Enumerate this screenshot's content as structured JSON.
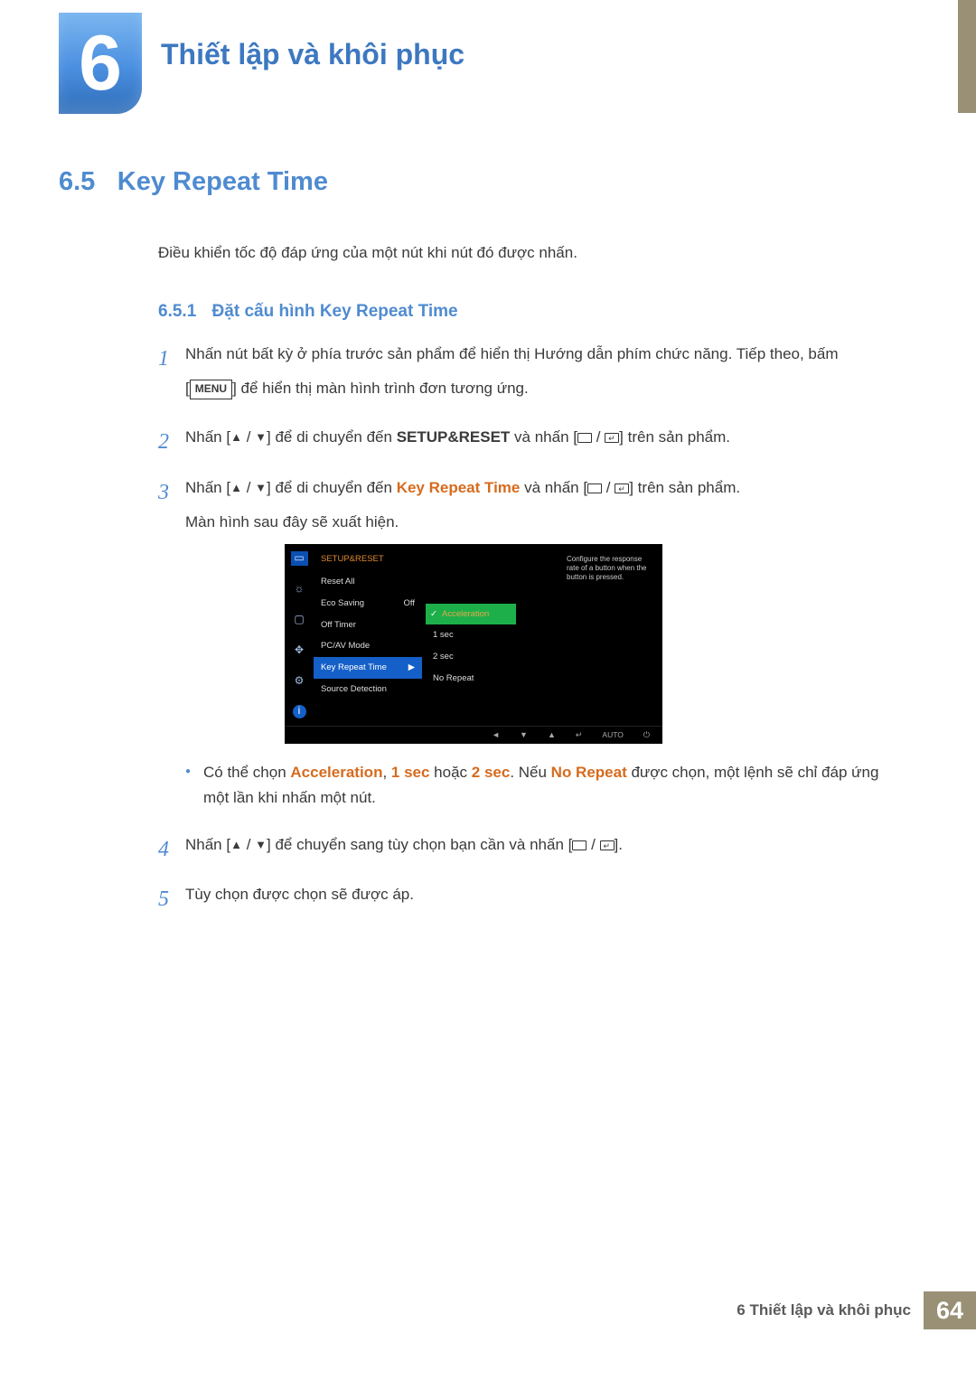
{
  "chapter": {
    "number": "6",
    "title": "Thiết lập và khôi phục"
  },
  "section": {
    "number": "6.5",
    "title": "Key Repeat Time",
    "description": "Điều khiển tốc độ đáp ứng của một nút khi nút đó được nhấn."
  },
  "subsection": {
    "number": "6.5.1",
    "title": "Đặt cấu hình Key Repeat Time"
  },
  "menu_label": "MENU",
  "setup_reset": "SETUP&RESET",
  "key_repeat_time": "Key Repeat Time",
  "steps": {
    "s1a": "Nhấn nút bất kỳ ở phía trước sản phẩm để hiển thị Hướng dẫn phím chức năng. Tiếp theo, bấm",
    "s1b_prefix": "[",
    "s1b_suffix": "] để hiển thị màn hình trình đơn tương ứng.",
    "s2_prefix": "Nhấn [",
    "s2_mid": "] để di chuyển đến ",
    "s2_suffix1": " và nhấn [",
    "s2_suffix2": "] trên sản phẩm.",
    "s3_prefix": "Nhấn [",
    "s3_mid": "] để di chuyển đến ",
    "s3_suffix1": " và nhấn [",
    "s3_suffix2": "] trên sản phẩm.",
    "s3_tail": "Màn hình sau đây sẽ xuất hiện.",
    "bullet_prefix": "Có thể chọn ",
    "accel": "Acceleration",
    "sep1": ", ",
    "one_sec": "1 sec",
    "sep2": " hoặc ",
    "two_sec": "2 sec",
    "bullet_mid": ". Nếu ",
    "no_repeat": "No Repeat",
    "bullet_suffix": " được chọn, một lệnh sẽ chỉ đáp ứng một lần khi nhấn một nút.",
    "s4_prefix": "Nhấn [",
    "s4_mid": "] để chuyển sang tùy chọn bạn cần và nhấn [",
    "s4_suffix": "].",
    "s5": "Tùy chọn được chọn sẽ được áp."
  },
  "osd": {
    "header": "SETUP&RESET",
    "items": [
      {
        "label": "Reset All",
        "value": ""
      },
      {
        "label": "Eco Saving",
        "value": "Off"
      },
      {
        "label": "Off Timer",
        "value": ""
      },
      {
        "label": "PC/AV Mode",
        "value": ""
      },
      {
        "label": "Key Repeat Time",
        "value": ""
      },
      {
        "label": "Source Detection",
        "value": ""
      }
    ],
    "desc": "Configure the response rate of a button when the button is pressed.",
    "options": [
      "Acceleration",
      "1 sec",
      "2 sec",
      "No Repeat"
    ],
    "bottom_auto": "AUTO"
  },
  "footer": {
    "chapter_ref": "6 Thiết lập và khôi phục",
    "page": "64"
  }
}
